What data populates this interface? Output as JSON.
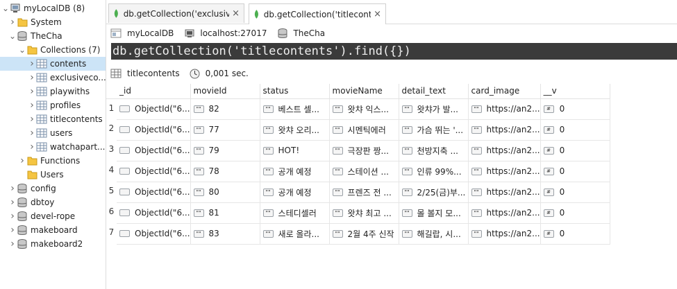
{
  "sidebar": {
    "items": [
      {
        "label": "myLocalDB (8)",
        "icon": "computer-icon",
        "level": 0,
        "expand": "open"
      },
      {
        "label": "System",
        "icon": "folder-icon",
        "level": 1,
        "expand": "closed"
      },
      {
        "label": "TheCha",
        "icon": "database-icon",
        "level": 1,
        "expand": "open"
      },
      {
        "label": "Collections (7)",
        "icon": "folder-icon",
        "level": 2,
        "expand": "open"
      },
      {
        "label": "contents",
        "icon": "collection-icon",
        "level": 3,
        "expand": "closed",
        "selected": true
      },
      {
        "label": "exclusiveco...",
        "icon": "collection-icon",
        "level": 3,
        "expand": "closed"
      },
      {
        "label": "playwiths",
        "icon": "collection-icon",
        "level": 3,
        "expand": "closed"
      },
      {
        "label": "profiles",
        "icon": "collection-icon",
        "level": 3,
        "expand": "closed"
      },
      {
        "label": "titlecontents",
        "icon": "collection-icon",
        "level": 3,
        "expand": "closed"
      },
      {
        "label": "users",
        "icon": "collection-icon",
        "level": 3,
        "expand": "closed"
      },
      {
        "label": "watchapart...",
        "icon": "collection-icon",
        "level": 3,
        "expand": "closed"
      },
      {
        "label": "Functions",
        "icon": "folder-icon",
        "level": 2,
        "expand": "closed"
      },
      {
        "label": "Users",
        "icon": "folder-icon",
        "level": 2,
        "expand": "none"
      },
      {
        "label": "config",
        "icon": "database-icon",
        "level": 1,
        "expand": "closed"
      },
      {
        "label": "dbtoy",
        "icon": "database-icon",
        "level": 1,
        "expand": "closed"
      },
      {
        "label": "devel-rope",
        "icon": "database-icon",
        "level": 1,
        "expand": "closed"
      },
      {
        "label": "makeboard",
        "icon": "database-icon",
        "level": 1,
        "expand": "closed"
      },
      {
        "label": "makeboard2",
        "icon": "database-icon",
        "level": 1,
        "expand": "closed"
      }
    ]
  },
  "tabs": [
    {
      "label": "db.getCollection('exclusiv",
      "close": "×",
      "active": false
    },
    {
      "label": "db.getCollection('titleconte",
      "close": "×",
      "active": true
    }
  ],
  "connection": {
    "connection_name": "myLocalDB",
    "host": "localhost:27017",
    "database": "TheCha"
  },
  "query": {
    "text": "db.getCollection('titlecontents').find({})"
  },
  "result": {
    "collection": "titlecontents",
    "time": "0,001 sec."
  },
  "table": {
    "columns": [
      "_id",
      "movieId",
      "status",
      "movieName",
      "detail_text",
      "card_image",
      "__v"
    ],
    "text_badge": "\"\"",
    "num_badge": "#",
    "rows": [
      {
        "num": "1",
        "id": "ObjectId(\"6...",
        "movieId": "82",
        "status": "베스트 셀...",
        "movieName": "왓챠 익스...",
        "detail_text": "왓챠가 발...",
        "card_image": "https://an2...",
        "v": "0"
      },
      {
        "num": "2",
        "id": "ObjectId(\"6...",
        "movieId": "77",
        "status": "왓챠 오리...",
        "movieName": "시멘틱에러",
        "detail_text": "가슴 뛰는 '...",
        "card_image": "https://an2...",
        "v": "0"
      },
      {
        "num": "3",
        "id": "ObjectId(\"6...",
        "movieId": "79",
        "status": "HOT!",
        "movieName": "극장판 짱...",
        "detail_text": "천방지축 ...",
        "card_image": "https://an2...",
        "v": "0"
      },
      {
        "num": "4",
        "id": "ObjectId(\"6...",
        "movieId": "78",
        "status": "공개 예정",
        "movieName": "스테이션 ...",
        "detail_text": "인류 99%...",
        "card_image": "https://an2...",
        "v": "0"
      },
      {
        "num": "5",
        "id": "ObjectId(\"6...",
        "movieId": "80",
        "status": "공개 예정",
        "movieName": "프렌즈 전 ...",
        "detail_text": "2/25(금)부...",
        "card_image": "https://an2...",
        "v": "0"
      },
      {
        "num": "6",
        "id": "ObjectId(\"6...",
        "movieId": "81",
        "status": "스테디셀러",
        "movieName": "왓챠 최고 ...",
        "detail_text": "몰 볼지 모...",
        "card_image": "https://an2...",
        "v": "0"
      },
      {
        "num": "7",
        "id": "ObjectId(\"6...",
        "movieId": "83",
        "status": "새로 올라...",
        "movieName": "2월 4주 신작",
        "detail_text": "해길랍, 시...",
        "card_image": "https://an2...",
        "v": "0"
      }
    ]
  },
  "colors": {
    "accent": "#cce4f7",
    "query_bg": "#3b3b3b",
    "folder": "#f5c542",
    "leaf": "#4caf50"
  }
}
